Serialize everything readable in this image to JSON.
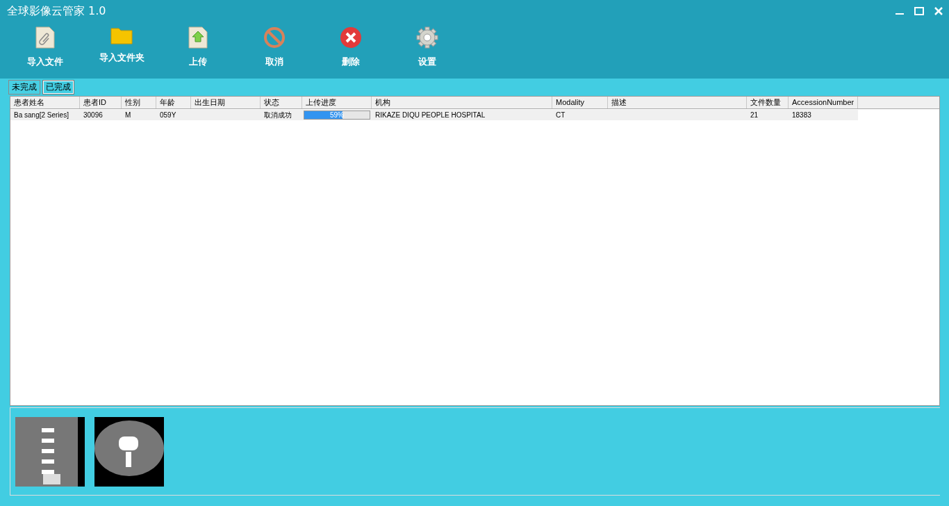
{
  "window": {
    "title": "全球影像云管家 1.0"
  },
  "toolbar": [
    {
      "kind": "file",
      "label": "导入文件"
    },
    {
      "kind": "folder",
      "label": "导入文件夹"
    },
    {
      "kind": "upload",
      "label": "上传"
    },
    {
      "kind": "cancel",
      "label": "取消"
    },
    {
      "kind": "delete",
      "label": "删除"
    },
    {
      "kind": "settings",
      "label": "设置"
    }
  ],
  "tabs": [
    {
      "label": "未完成",
      "selected": false
    },
    {
      "label": "已完成",
      "selected": true
    }
  ],
  "table": {
    "columns": [
      "患者姓名",
      "患者ID",
      "性别",
      "年龄",
      "出生日期",
      "状态",
      "上传进度",
      "机构",
      "Modality",
      "描述",
      "文件数量",
      "AccessionNumber"
    ],
    "rows": [
      {
        "cells": [
          "Ba sang[2 Series]",
          "30096",
          "M",
          "059Y",
          "",
          "取消成功",
          {
            "level": 0.59,
            "reading": "59%"
          },
          "RIKAZE DIQU PEOPLE HOSPITAL",
          "CT",
          "",
          "21",
          "18383"
        ]
      }
    ]
  },
  "thumbnails": [
    {
      "kind": "sagittal"
    },
    {
      "kind": "axial"
    }
  ]
}
